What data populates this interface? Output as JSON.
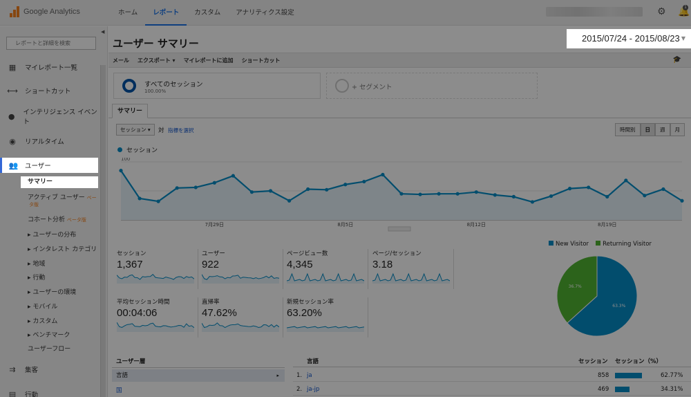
{
  "header": {
    "logo_text": "Google Analytics",
    "nav": [
      "ホーム",
      "レポート",
      "カスタム",
      "アナリティクス設定"
    ],
    "active_nav": 1,
    "notification_count": "1"
  },
  "sidebar": {
    "search_placeholder": "レポートと詳細を検索",
    "items": [
      {
        "label": "マイレポート一覧",
        "icon": "grid-icon"
      },
      {
        "label": "ショートカット",
        "icon": "shortcut-icon"
      },
      {
        "label": "インテリジェンス イベント",
        "icon": "bulb-icon"
      },
      {
        "label": "リアルタイム",
        "icon": "realtime-icon"
      },
      {
        "label": "ユーザー",
        "icon": "users-icon"
      }
    ],
    "sub_items": [
      "サマリー",
      "アクティブ ユーザー",
      "コホート分析",
      "ユーザーの分布",
      "インタレスト カテゴリ",
      "地域",
      "行動",
      "ユーザーの環境",
      "モバイル",
      "カスタム",
      "ベンチマーク",
      "ユーザーフロー"
    ],
    "beta_label_1": "ベー",
    "beta_label_1b": "タ版",
    "beta_label_2": "ベータ版",
    "bottom_items": [
      {
        "label": "集客",
        "icon": "acquisition-icon"
      },
      {
        "label": "行動",
        "icon": "behavior-icon"
      }
    ]
  },
  "main": {
    "title": "ユーザー サマリー",
    "date_range": "2015/07/24 - 2015/08/23",
    "actions": [
      "メール",
      "エクスポート ▾",
      "マイレポートに追加",
      "ショートカット"
    ],
    "segment_all": "すべてのセッション",
    "segment_all_pct": "100.00%",
    "segment_add": "+ セグメント",
    "tab": "サマリー",
    "metric_select": "セッション",
    "vs": "対",
    "pick_metric": "指標を選択",
    "time_buttons": [
      "時間別",
      "日",
      "週",
      "月"
    ],
    "active_time": 1,
    "legend": "セッション",
    "scorecards": [
      {
        "label": "セッション",
        "value": "1,367"
      },
      {
        "label": "ユーザー",
        "value": "922"
      },
      {
        "label": "ページビュー数",
        "value": "4,345"
      },
      {
        "label": "ページ/セッション",
        "value": "3.18"
      },
      {
        "label": "平均セッション時間",
        "value": "00:04:06"
      },
      {
        "label": "直帰率",
        "value": "47.62%"
      },
      {
        "label": "新規セッション率",
        "value": "63.20%"
      }
    ],
    "pie": {
      "legend": [
        {
          "name": "New Visitor",
          "color": "#058dc7"
        },
        {
          "name": "Returning Visitor",
          "color": "#50b432"
        }
      ],
      "labels": [
        "63.3%",
        "36.7%"
      ]
    },
    "bottom": {
      "left_header": "ユーザー層",
      "left_selected": "言語",
      "left_next": "国",
      "columns": [
        "言語",
        "セッション",
        "セッション（%）"
      ],
      "rows": [
        {
          "rank": "1.",
          "lang": "ja",
          "sessions": "858",
          "pct": "62.77%",
          "frac": 0.6277
        },
        {
          "rank": "2.",
          "lang": "ja-jp",
          "sessions": "469",
          "pct": "34.31%",
          "frac": 0.3431
        }
      ]
    }
  },
  "chart_data": [
    {
      "type": "line",
      "legend": "セッション",
      "x": [
        "7/24",
        "7/25",
        "7/26",
        "7/27",
        "7/28",
        "7/29",
        "7/30",
        "7/31",
        "8/1",
        "8/2",
        "8/3",
        "8/4",
        "8/5",
        "8/6",
        "8/7",
        "8/8",
        "8/9",
        "8/10",
        "8/11",
        "8/12",
        "8/13",
        "8/14",
        "8/15",
        "8/16",
        "8/17",
        "8/18",
        "8/19",
        "8/20",
        "8/21",
        "8/22",
        "8/23"
      ],
      "values": [
        85,
        37,
        32,
        55,
        56,
        64,
        76,
        48,
        50,
        33,
        53,
        52,
        61,
        66,
        78,
        45,
        44,
        45,
        45,
        48,
        43,
        40,
        31,
        41,
        54,
        56,
        40,
        68,
        42,
        53,
        33
      ],
      "x_tick_labels": [
        "7月29日",
        "8月5日",
        "8月12日",
        "8月19日"
      ],
      "y_tick_labels": [
        "100",
        "50"
      ],
      "ylim": [
        0,
        100
      ],
      "color": "#058dc7"
    },
    {
      "type": "pie",
      "categories": [
        "New Visitor",
        "Returning Visitor"
      ],
      "values": [
        63.3,
        36.7
      ],
      "colors": [
        "#058dc7",
        "#50b432"
      ]
    }
  ]
}
